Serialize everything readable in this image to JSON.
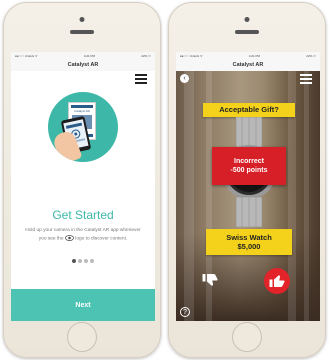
{
  "left_phone": {
    "status": {
      "carrier": "●●○○○ Unlock ᯤ",
      "time": "4:21 PM",
      "battery": "22% ▭"
    },
    "app_title": "Catalyst AR",
    "illustration": {
      "brochure_logo": "Catalyst AR"
    },
    "heading": "Get Started",
    "instructions": {
      "part1": "Hold up your camera in the Catalyst AR app whenever you see the",
      "part2": "logo to discover content."
    },
    "pager": {
      "count": 4,
      "active_index": 0
    },
    "next_label": "Next"
  },
  "right_phone": {
    "status": {
      "carrier": "●●○○○ Unlock ᯤ",
      "time": "4:21 PM",
      "battery": "22% ▭"
    },
    "app_title": "Catalyst AR",
    "question": "Acceptable Gift?",
    "result": {
      "line1": "Incorrect",
      "line2": "-500 points"
    },
    "item": {
      "name": "Swiss Watch",
      "price": "$5,000"
    },
    "icons": {
      "back": "back-arrow-icon",
      "thumb_down": "thumbs-down-icon",
      "thumb_up": "thumbs-up-icon",
      "help": "help-icon"
    }
  },
  "colors": {
    "teal": "#4cc3b3",
    "yellow": "#f4d21b",
    "red": "#d61f26"
  }
}
